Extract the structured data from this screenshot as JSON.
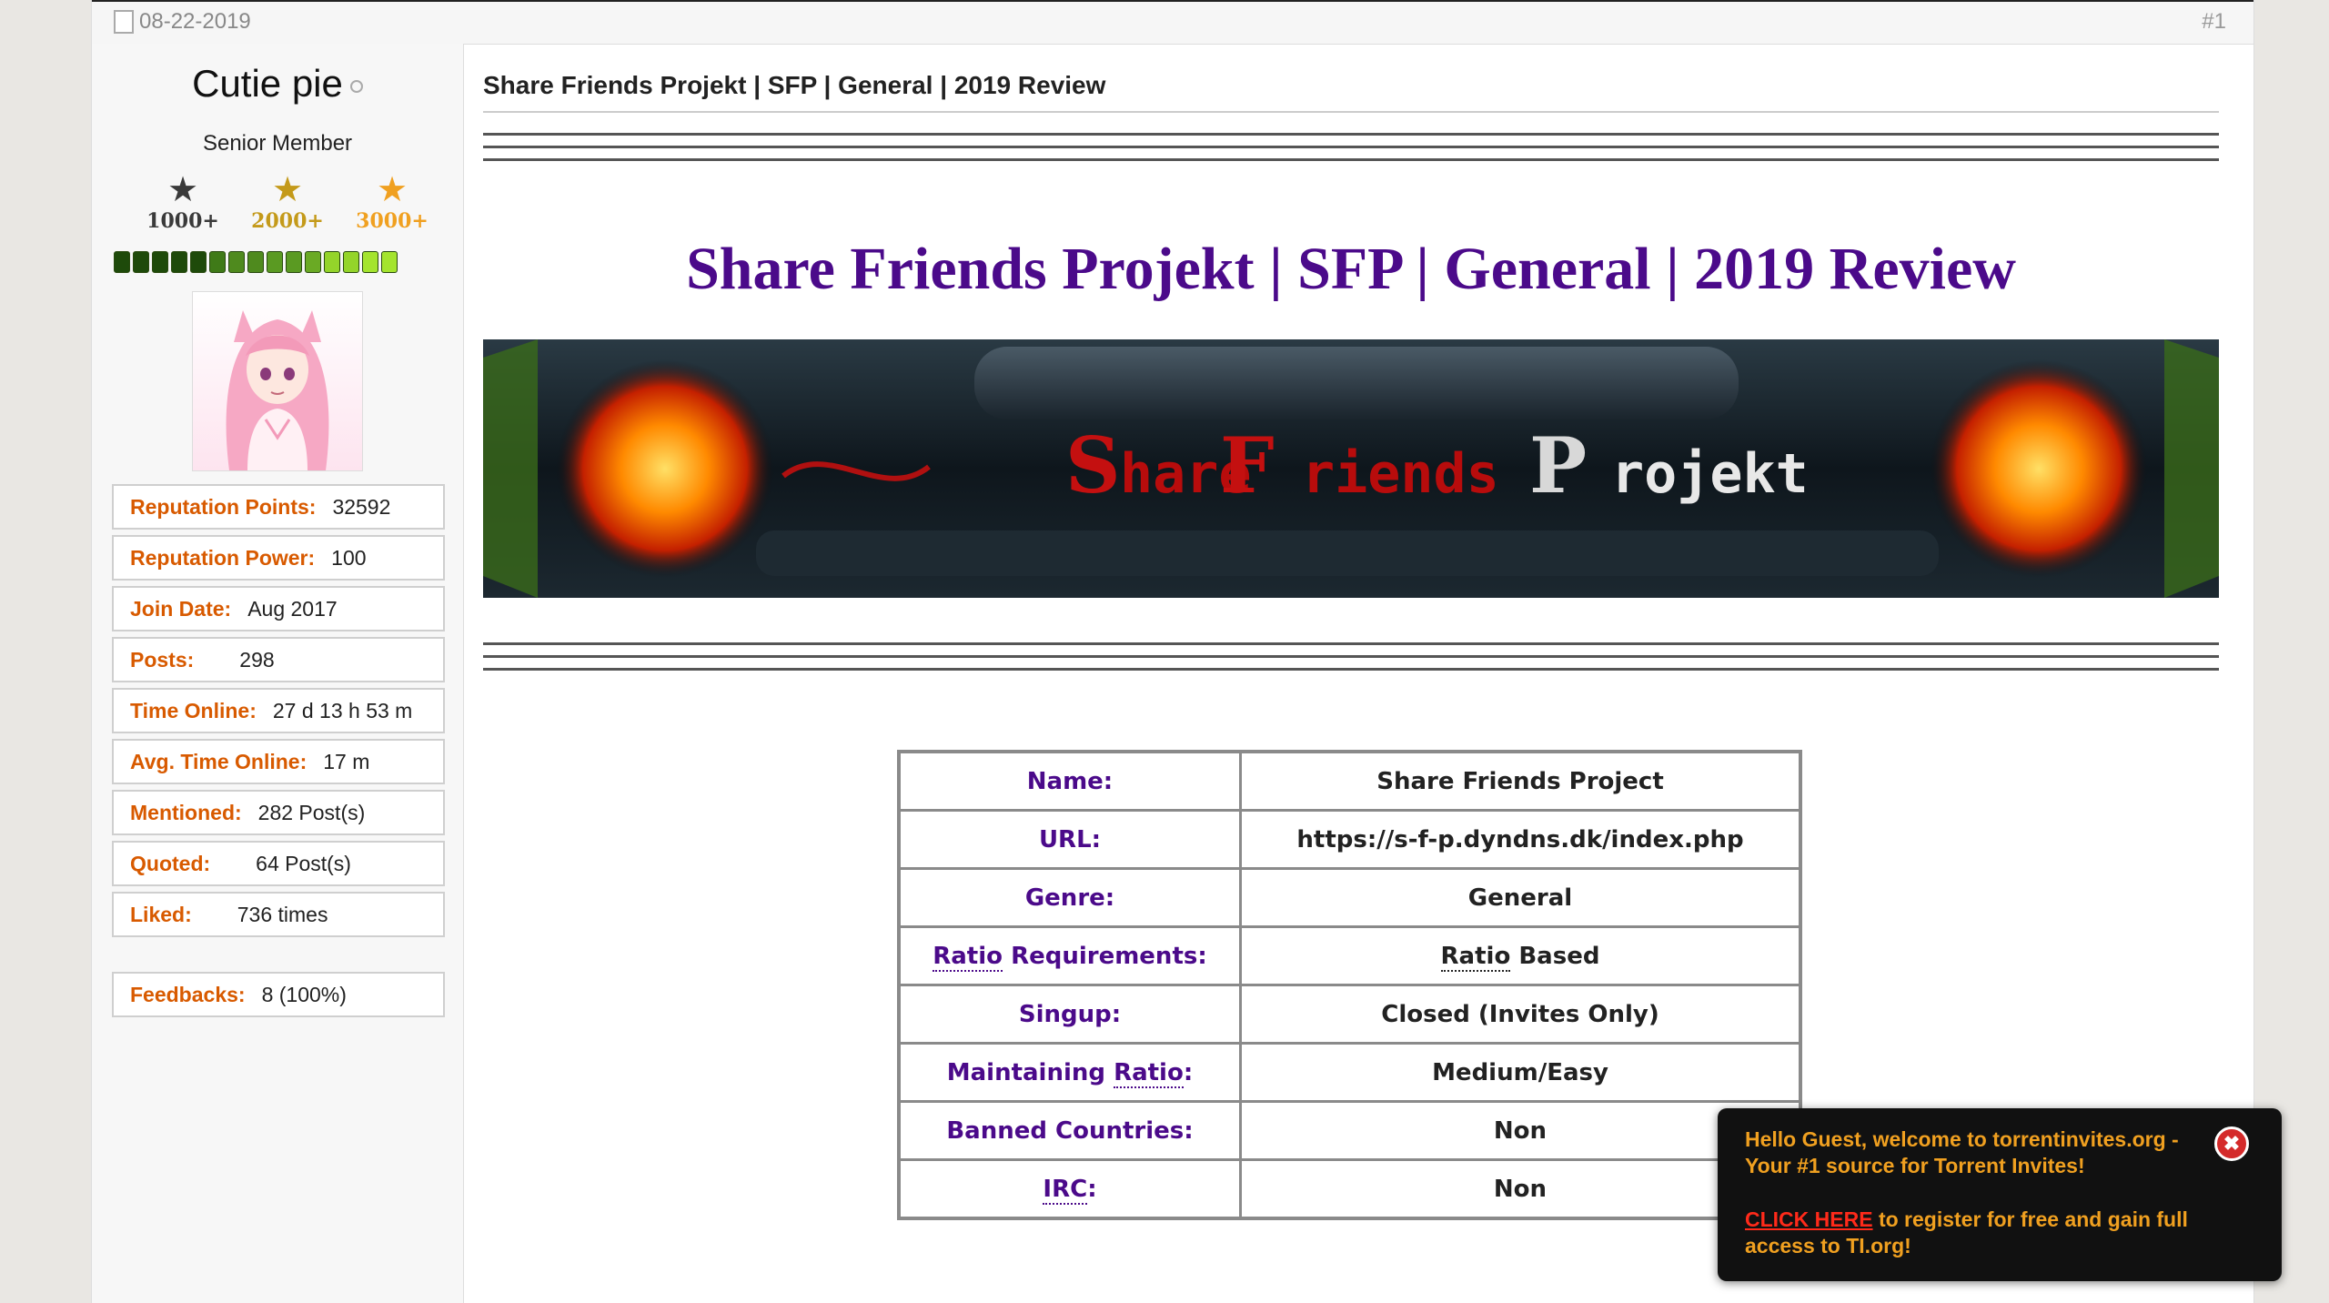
{
  "post": {
    "date": "08-22-2019",
    "number": "#1",
    "title": "Share Friends Projekt | SFP | General | 2019 Review"
  },
  "user": {
    "name": "Cutie pie",
    "title": "Senior Member",
    "stars": [
      {
        "label": "1000+",
        "color": "#3a3a3a"
      },
      {
        "label": "2000+",
        "color": "#c49a1a"
      },
      {
        "label": "3000+",
        "color": "#f0a020"
      }
    ],
    "rep_bar_colors": [
      "#1e4a0a",
      "#1e4a0a",
      "#1e4a0a",
      "#1e4a0a",
      "#1e4a0a",
      "#3f7a18",
      "#4f8a1e",
      "#4f8a1e",
      "#5a9a22",
      "#5a9a22",
      "#6aaa24",
      "#94d42a",
      "#94d42a",
      "#a4e42e",
      "#a4e42e"
    ],
    "stats": [
      {
        "key": "Reputation Points:",
        "value": "32592"
      },
      {
        "key": "Reputation Power:",
        "value": "100"
      },
      {
        "key": "Join Date:",
        "value": "Aug 2017"
      },
      {
        "key": "Posts:",
        "value": "298"
      },
      {
        "key": "Time Online:",
        "value": "27 d 13 h 53 m"
      },
      {
        "key": "Avg. Time Online:",
        "value": "17 m"
      },
      {
        "key": "Mentioned:",
        "value": "282 Post(s)"
      },
      {
        "key": "Quoted:",
        "value": "64 Post(s)"
      },
      {
        "key": "Liked:",
        "value": "736 times"
      }
    ],
    "feedback": {
      "key": "Feedbacks:",
      "value": "8 (100%)"
    }
  },
  "review": {
    "heading": "Share Friends Projekt | SFP | General | 2019 Review",
    "banner_text": {
      "s1": "S",
      "w1": "hare",
      "s2": "F",
      "w2": "riends",
      "s3": "P",
      "w3": "rojekt"
    },
    "rows": [
      {
        "key": "Name:",
        "value": "Share Friends Project"
      },
      {
        "key": "URL:",
        "value": "https://s-f-p.dyndns.dk/index.php"
      },
      {
        "key": "Genre:",
        "value": "General"
      },
      {
        "key_link": "Ratio",
        "key_rest": " Requirements:",
        "value_link": "Ratio",
        "value_rest": " Based"
      },
      {
        "key": "Singup:",
        "value": "Closed (Invites Only)"
      },
      {
        "key_pre": "Maintaining ",
        "key_link": "Ratio",
        "key_rest": ":",
        "value": "Medium/Easy"
      },
      {
        "key": "Banned Countries:",
        "value": "Non"
      },
      {
        "key_link": "IRC",
        "key_rest": ":",
        "value": "Non"
      }
    ]
  },
  "popup": {
    "message": "Hello Guest, welcome to torrentinvites.org - Your #1 source for Torrent Invites!",
    "link": "CLICK HERE",
    "rest": " to register for free and gain full access to TI.org!",
    "close": "✖"
  }
}
